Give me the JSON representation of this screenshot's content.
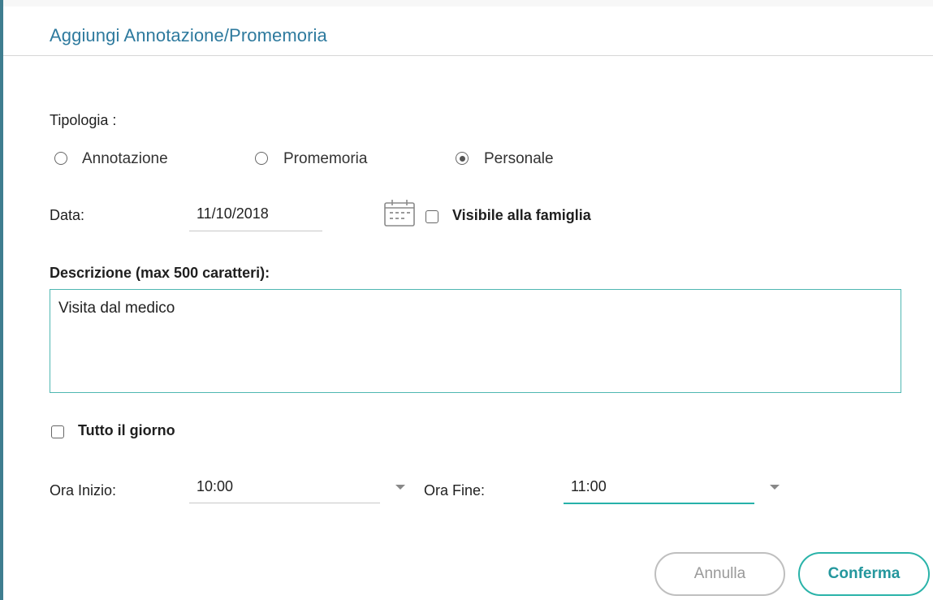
{
  "dialog": {
    "title": "Aggiungi Annotazione/Promemoria"
  },
  "tipologia": {
    "label": "Tipologia :",
    "options": [
      {
        "label": "Annotazione",
        "checked": false
      },
      {
        "label": "Promemoria",
        "checked": false
      },
      {
        "label": "Personale",
        "checked": true
      }
    ]
  },
  "data": {
    "label": "Data:",
    "value": "11/10/2018",
    "calendar_icon": "calendar-icon",
    "visible_to_family": {
      "label": "Visibile alla famiglia",
      "checked": false
    }
  },
  "description": {
    "label": "Descrizione (max 500 caratteri):",
    "value": "Visita dal medico"
  },
  "all_day": {
    "label": "Tutto il giorno",
    "checked": false
  },
  "start_time": {
    "label": "Ora Inizio:",
    "value": "10:00"
  },
  "end_time": {
    "label": "Ora Fine:",
    "value": "11:00"
  },
  "buttons": {
    "cancel": "Annulla",
    "confirm": "Conferma"
  },
  "colors": {
    "accent": "#2ab3a9",
    "title": "#2e7a9e",
    "frame": "#3f7d8f"
  }
}
